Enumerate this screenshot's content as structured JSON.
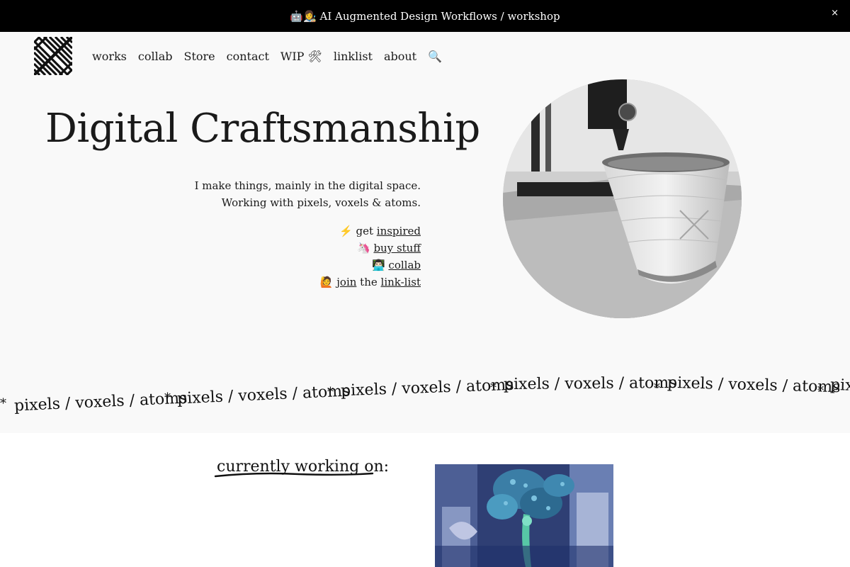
{
  "banner": {
    "text": "🤖👩‍🎨 AI Augmented Design Workflows / workshop",
    "close_label": "×"
  },
  "nav": {
    "items": [
      "works",
      "collab",
      "Store",
      "contact",
      "WIP 🛠",
      "linklist",
      "about"
    ],
    "search_icon": "🔍"
  },
  "hero": {
    "title": "Digital Craftsmanship",
    "intro_line_1": "I make things, mainly in the digital space.",
    "intro_line_2": "Working with pixels, voxels & atoms.",
    "links": {
      "inspired_prefix": "⚡ get ",
      "inspired_link": "inspired",
      "buy_prefix": "🦄 ",
      "buy_link": "buy stuff",
      "collab_prefix": "👨🏻‍💻 ",
      "collab_link": "collab",
      "join_prefix": "🙋 ",
      "join_link": "join",
      "join_middle": " the ",
      "linklist_link": "link-list"
    }
  },
  "marquee": {
    "text": "pixels / voxels / atoms",
    "separator": "*"
  },
  "working": {
    "heading": "currently working on:"
  },
  "colors": {
    "banner_bg": "#000000",
    "hero_bg": "#f9f9f9",
    "text": "#1a1a1a"
  }
}
